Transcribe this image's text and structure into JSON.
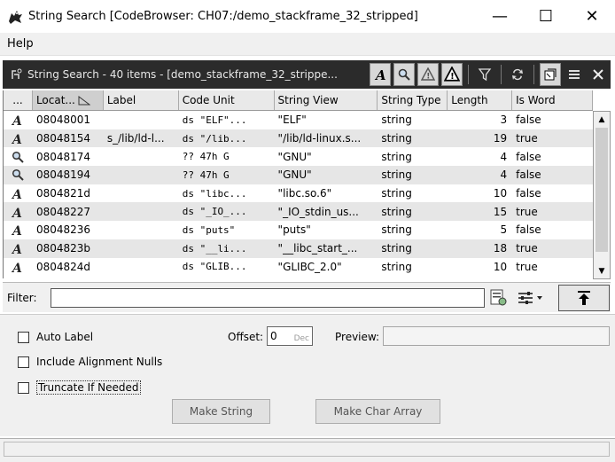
{
  "window": {
    "title": "String Search [CodeBrowser: CH07:/demo_stackframe_32_stripped]",
    "minimize": "—",
    "maximize": "☐",
    "close": "✕"
  },
  "menu": {
    "items": [
      "Help"
    ]
  },
  "component": {
    "title": "String Search - 40 items - [demo_stackframe_32_strippe..."
  },
  "table": {
    "headers": [
      "...",
      "Locat...",
      "Label",
      "Code Unit",
      "String View",
      "String Type",
      "Length",
      "Is Word"
    ],
    "rows": [
      {
        "icon": "defined-string-icon",
        "location": "08048001",
        "label": "",
        "code_unit": "ds \"ELF\"...",
        "string_view": "\"ELF\"",
        "string_type": "string",
        "length": "3",
        "is_word": "false"
      },
      {
        "icon": "defined-string-icon",
        "location": "08048154",
        "label": "s_/lib/ld-l...",
        "code_unit": "ds \"/lib...",
        "string_view": "\"/lib/ld-linux.s...",
        "string_type": "string",
        "length": "19",
        "is_word": "true"
      },
      {
        "icon": "undefined-string-icon",
        "location": "08048174",
        "label": "",
        "code_unit": "?? 47h     G",
        "string_view": "\"GNU\"",
        "string_type": "string",
        "length": "4",
        "is_word": "false"
      },
      {
        "icon": "undefined-string-icon",
        "location": "08048194",
        "label": "",
        "code_unit": "?? 47h     G",
        "string_view": "\"GNU\"",
        "string_type": "string",
        "length": "4",
        "is_word": "false"
      },
      {
        "icon": "defined-string-icon",
        "location": "0804821d",
        "label": "",
        "code_unit": "ds \"libc...",
        "string_view": "\"libc.so.6\"",
        "string_type": "string",
        "length": "10",
        "is_word": "false"
      },
      {
        "icon": "defined-string-icon",
        "location": "08048227",
        "label": "",
        "code_unit": "ds \"_IO_...",
        "string_view": "\"_IO_stdin_us...",
        "string_type": "string",
        "length": "15",
        "is_word": "true"
      },
      {
        "icon": "defined-string-icon",
        "location": "08048236",
        "label": "",
        "code_unit": "ds \"puts\"",
        "string_view": "\"puts\"",
        "string_type": "string",
        "length": "5",
        "is_word": "false"
      },
      {
        "icon": "defined-string-icon",
        "location": "0804823b",
        "label": "",
        "code_unit": "ds \"__li...",
        "string_view": "\"__libc_start_...",
        "string_type": "string",
        "length": "18",
        "is_word": "true"
      },
      {
        "icon": "defined-string-icon",
        "location": "0804824d",
        "label": "",
        "code_unit": "ds \"GLIB...",
        "string_view": "\"GLIBC_2.0\"",
        "string_type": "string",
        "length": "10",
        "is_word": "true"
      }
    ]
  },
  "filter": {
    "label": "Filter:",
    "value": ""
  },
  "options": {
    "auto_label": "Auto Label",
    "include_alignment_nulls": "Include Alignment Nulls",
    "truncate_if_needed": "Truncate If Needed",
    "offset_label": "Offset:",
    "offset_value": "0",
    "offset_unit": "Dec",
    "preview_label": "Preview:",
    "preview_value": "",
    "make_string": "Make String",
    "make_char_array": "Make Char Array"
  }
}
